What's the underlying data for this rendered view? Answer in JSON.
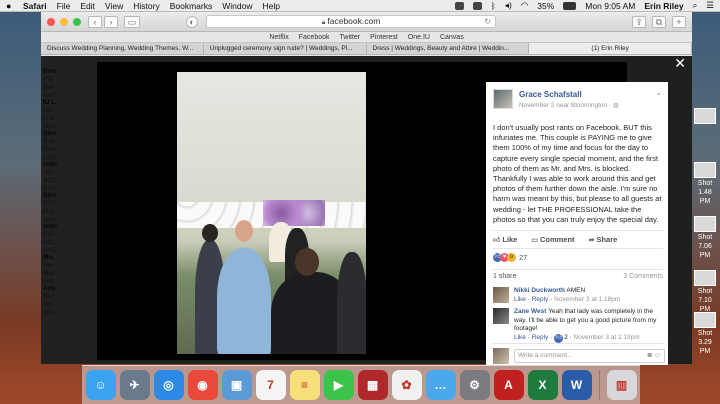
{
  "menubar": {
    "app": "Safari",
    "items": [
      "File",
      "Edit",
      "View",
      "History",
      "Bookmarks",
      "Window",
      "Help"
    ],
    "battery": "35%",
    "clock": "Mon 9:05 AM",
    "user": "Erin Riley"
  },
  "browser": {
    "url": "facebook.com",
    "favorites": [
      "Netflix",
      "Facebook",
      "Twitter",
      "Pinterest",
      "One.IU",
      "Canvas"
    ],
    "tabs": [
      "Discuss Wedding Planning, Wedding Themes, W...",
      "Unplugged ceremony sign rude? | Weddings, Pl...",
      "Dress | Weddings, Beauty and Attire | Weddin...",
      "(1) Erin Riley"
    ],
    "active_tab_index": 3
  },
  "fb_sidebar": [
    {
      "title": "Stro",
      "lines": [
        "FW",
        "Hall",
        "conf"
      ]
    },
    {
      "title": "IU L",
      "lines": [
        "Libr",
        "Frid",
        "infor"
      ]
    },
    {
      "title": "Stro",
      "lines": [
        "Sub",
        "Goo",
        "Logi"
      ]
    },
    {
      "title": "orde",
      "lines": [
        "You",
        "ADO",
        "SHE"
      ]
    },
    {
      "title": "Stro",
      "lines": [
        "GOT",
        "May",
        "on w"
      ]
    },
    {
      "title": "orde",
      "lines": [
        "Part",
        "ADO",
        "SHE"
      ]
    },
    {
      "title": "Mic",
      "lines": [
        "Aeri",
        "Micr",
        "edit"
      ]
    },
    {
      "title": "Ans",
      "lines": [
        "Rec",
        "heiv",
        "You"
      ]
    }
  ],
  "post": {
    "author": "Grace Schafstall",
    "meta": "November 2 near Bloomington · ",
    "text": "I don't usually post rants on Facebook. BUT this infuriates me. This couple is PAYING me to give them 100% of my time and focus for the day to capture every single special moment, and the first photo of them as Mr. and Mrs. is blocked. Thankfully I was able to work around this and get photos of them further down the aisle. I'm sure no harm was meant by this, but please to all guests at wedding - let THE PROFESSIONAL take the photos so that you can truly enjoy the special day.",
    "like_label": "Like",
    "comment_label": "Comment",
    "share_label": "Share",
    "reaction_count": "27",
    "shares": "1 share",
    "comments_count": "3 Comments",
    "comments": [
      {
        "name": "Nikki Duckworth",
        "text": "AMEN",
        "like": "Like",
        "reply": "Reply",
        "date": "November 3 at 1:18pm"
      },
      {
        "name": "Zane West",
        "text": "Yeah that lady was completely in the way. I'll be able to get you a good picture from my footage!",
        "like": "Like",
        "reply": "Reply",
        "date": "November 3 at 1:19pm",
        "likes": "2"
      }
    ],
    "write_placeholder": "Write a comment..."
  },
  "desktop_icons": [
    {
      "line1": "",
      "line2": ""
    },
    {
      "line1": "Shot",
      "line2": "1.48 PM"
    },
    {
      "line1": "Shot",
      "line2": "7.06 PM"
    },
    {
      "line1": "Shot",
      "line2": "7.10 PM"
    },
    {
      "line1": "Shot",
      "line2": "3.29 PM"
    }
  ],
  "dock": [
    {
      "icon": "finder-icon",
      "color": "#3aa3f0",
      "glyph": "☺"
    },
    {
      "icon": "launchpad-icon",
      "color": "#6a7a8a",
      "glyph": "✈"
    },
    {
      "icon": "safari-icon",
      "color": "#2a8ae6",
      "glyph": "◎"
    },
    {
      "icon": "chrome-icon",
      "color": "#e8493a",
      "glyph": "◉"
    },
    {
      "icon": "preview-icon",
      "color": "#5a9ad6",
      "glyph": "▣"
    },
    {
      "icon": "calendar-icon",
      "color": "#f4f4f4",
      "glyph": "7"
    },
    {
      "icon": "notes-icon",
      "color": "#f7e07a",
      "glyph": "≡"
    },
    {
      "icon": "facetime-icon",
      "color": "#3cc34a",
      "glyph": "▶"
    },
    {
      "icon": "photo-booth-icon",
      "color": "#b0282a",
      "glyph": "▦"
    },
    {
      "icon": "photos-icon",
      "color": "#f0f0f0",
      "glyph": "✿"
    },
    {
      "icon": "messages-icon",
      "color": "#4aa8ec",
      "glyph": "…"
    },
    {
      "icon": "system-preferences-icon",
      "color": "#7a7a80",
      "glyph": "⚙"
    },
    {
      "icon": "acrobat-icon",
      "color": "#c0201e",
      "glyph": "A"
    },
    {
      "icon": "excel-icon",
      "color": "#1f7a3e",
      "glyph": "X"
    },
    {
      "icon": "word-icon",
      "color": "#2a5caa",
      "glyph": "W"
    },
    {
      "icon": "trash-icon",
      "color": "#d8d8dc",
      "glyph": "▥"
    }
  ]
}
